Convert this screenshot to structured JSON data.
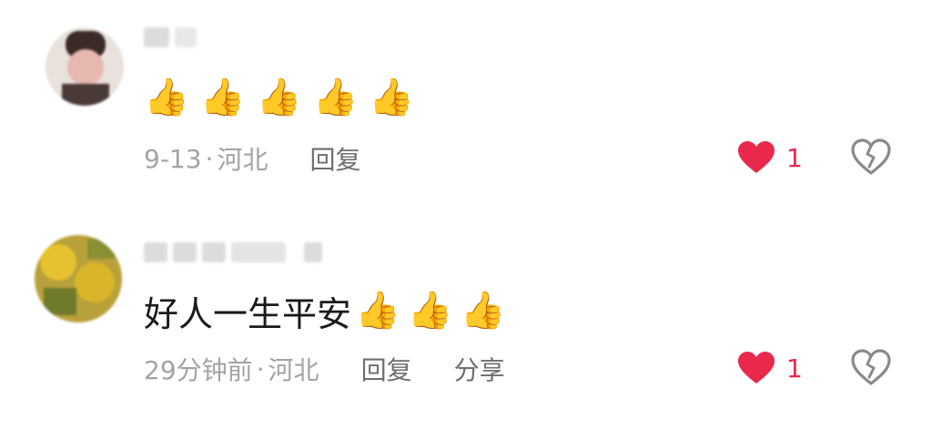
{
  "comments": [
    {
      "text": "",
      "emoji": [
        "👍",
        "👍",
        "👍",
        "👍",
        "👍"
      ],
      "time": "9-13",
      "separator": "·",
      "location": "河北",
      "reply_label": "回复",
      "share_label": "",
      "likes": "1"
    },
    {
      "text": "好人一生平安",
      "emoji": [
        "👍",
        "👍",
        "👍"
      ],
      "time": "29分钟前",
      "separator": "·",
      "location": "河北",
      "reply_label": "回复",
      "share_label": "分享",
      "likes": "1"
    }
  ],
  "colors": {
    "like_heart": "#e8294c",
    "meta_text": "#a3a3a3",
    "action_text": "#6e6e6e",
    "dislike_icon": "#8a8a8a"
  },
  "icons": [
    "avatar",
    "thumbs-up-emoji",
    "heart-icon",
    "broken-heart-icon"
  ]
}
